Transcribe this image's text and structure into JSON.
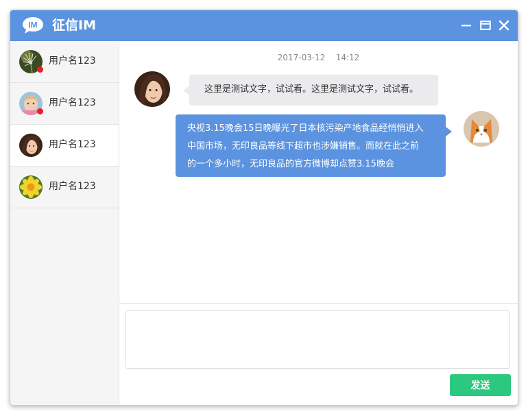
{
  "app": {
    "logo_text": "IM",
    "title": "征信IM",
    "brand_color": "#5b93e0"
  },
  "window_controls": [
    {
      "icon": "minimize-icon"
    },
    {
      "icon": "maximize-icon"
    },
    {
      "icon": "close-icon"
    }
  ],
  "contacts": [
    {
      "name": "用户名123",
      "avatar": "dandelion-photo-avatar",
      "unread": true
    },
    {
      "name": "用户名123",
      "avatar": "child-photo-avatar",
      "unread": true
    },
    {
      "name": "用户名123",
      "avatar": "woman-photo-avatar",
      "unread": false,
      "active": true
    },
    {
      "name": "用户名123",
      "avatar": "flower-photo-avatar",
      "unread": false
    }
  ],
  "chat": {
    "timestamp": "2017-03-12    14:12",
    "messages": [
      {
        "direction": "incoming",
        "avatar": "woman-photo-avatar",
        "text": "这里是测试文字，试试看。这里是测试文字，试试看。"
      },
      {
        "direction": "outgoing",
        "avatar": "cat-photo-avatar",
        "lines": [
          "央视3.15晚会15日晚曝光了日本核污染产地食品经悄悄进入",
          "中国市场，无印良品等线下超市也涉嫌销售。而就在此之前",
          "的一个多小时，无印良品的官方微博却点赞3.15晚会"
        ]
      }
    ]
  },
  "composer": {
    "value": "",
    "send_label": "发送",
    "send_color": "#2dc87f"
  },
  "unread_color": "#ee1c24"
}
